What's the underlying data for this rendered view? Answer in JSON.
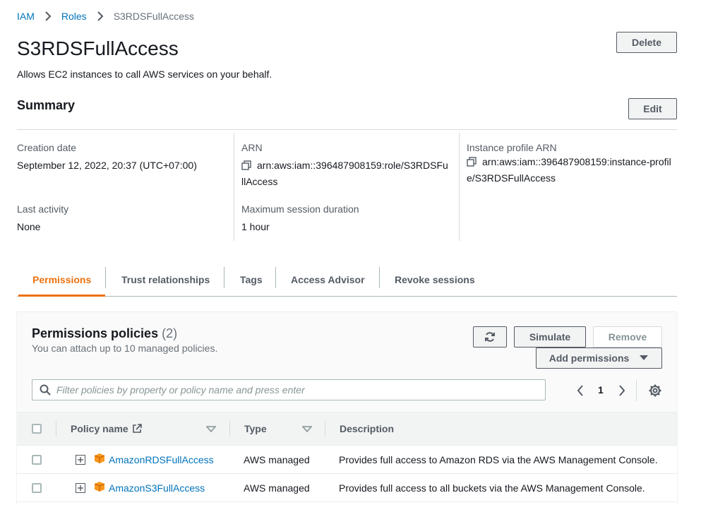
{
  "breadcrumb": {
    "root": "IAM",
    "parent": "Roles",
    "current": "S3RDSFullAccess"
  },
  "page": {
    "title": "S3RDSFullAccess",
    "description": "Allows EC2 instances to call AWS services on your behalf.",
    "delete_label": "Delete"
  },
  "summary": {
    "title": "Summary",
    "edit_label": "Edit",
    "creation_date_label": "Creation date",
    "creation_date_value": "September 12, 2022, 20:37 (UTC+07:00)",
    "arn_label": "ARN",
    "arn_line1": "arn:aws:iam::396487908159:role/S3RDSFu",
    "arn_line2": "llAccess",
    "instance_profile_label": "Instance profile ARN",
    "instance_profile_line1": "arn:aws:iam::396487908159:instance-profil",
    "instance_profile_line2": "e/S3RDSFullAccess",
    "last_activity_label": "Last activity",
    "last_activity_value": "None",
    "max_session_label": "Maximum session duration",
    "max_session_value": "1 hour"
  },
  "tabs": [
    "Permissions",
    "Trust relationships",
    "Tags",
    "Access Advisor",
    "Revoke sessions"
  ],
  "active_tab": "Permissions",
  "permissions": {
    "title": "Permissions policies",
    "count": "(2)",
    "subtitle": "You can attach up to 10 managed policies.",
    "simulate_label": "Simulate",
    "remove_label": "Remove",
    "add_permissions_label": "Add permissions",
    "search_placeholder": "Filter policies by property or policy name and press enter",
    "page_number": "1",
    "columns": {
      "policy_name": "Policy name",
      "type": "Type",
      "description": "Description"
    },
    "rows": [
      {
        "name": "AmazonRDSFullAccess",
        "type": "AWS managed",
        "description": "Provides full access to Amazon RDS via the AWS Management Console."
      },
      {
        "name": "AmazonS3FullAccess",
        "type": "AWS managed",
        "description": "Provides full access to all buckets via the AWS Management Console."
      }
    ]
  },
  "colors": {
    "link": "#0073bb",
    "accent": "#ec7211",
    "text": "#16191f",
    "muted": "#687078",
    "package_icon": "#f7981d"
  },
  "icons": [
    "chevron-right-icon",
    "copy-icon",
    "external-link-icon",
    "refresh-icon",
    "caret-down-icon",
    "search-icon",
    "chevron-left-icon",
    "settings-gear-icon",
    "expand-plus-icon",
    "package-icon"
  ]
}
